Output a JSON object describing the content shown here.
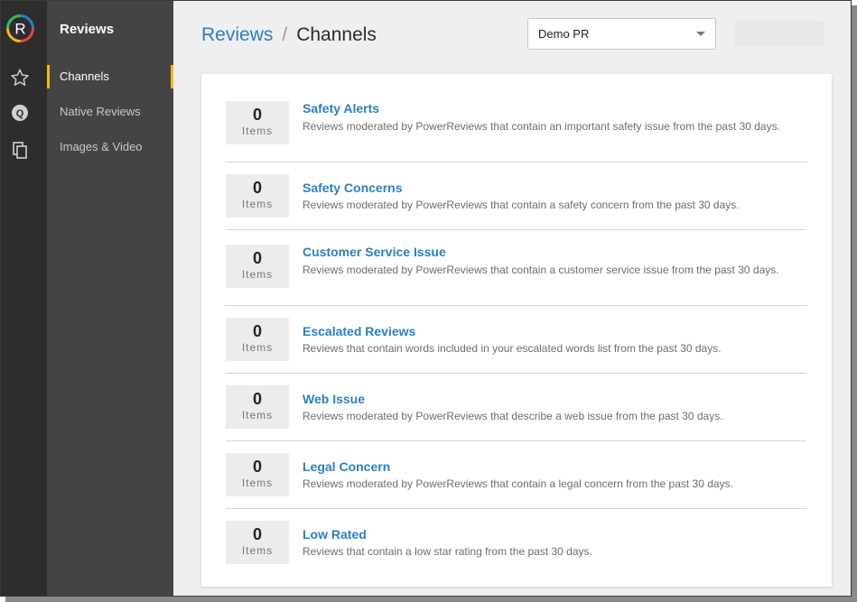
{
  "app": {
    "section": "Reviews"
  },
  "rail": {
    "logo_letter": "R",
    "icons": [
      "star-icon",
      "q-icon",
      "images-icon"
    ],
    "q_letter": "Q"
  },
  "nav": {
    "items": [
      {
        "label": "Channels",
        "active": true
      },
      {
        "label": "Native Reviews",
        "active": false
      },
      {
        "label": "Images & Video",
        "active": false
      }
    ]
  },
  "header": {
    "breadcrumb_root": "Reviews",
    "separator": "/",
    "breadcrumb_current": "Channels",
    "account_select": "Demo PR"
  },
  "channels": [
    {
      "count": "0",
      "unit": "Items",
      "title": "Safety Alerts",
      "description": "Reviews moderated by PowerReviews that contain an important safety issue from the past 30 days."
    },
    {
      "count": "0",
      "unit": "Items",
      "title": "Safety Concerns",
      "description": "Reviews moderated by PowerReviews that contain a safety concern from the past 30 days."
    },
    {
      "count": "0",
      "unit": "Items",
      "title": "Customer Service Issue",
      "description": "Reviews moderated by PowerReviews that contain a customer service issue from the past 30 days."
    },
    {
      "count": "0",
      "unit": "Items",
      "title": "Escalated Reviews",
      "description": "Reviews that contain words included in your escalated words list from the past 30 days."
    },
    {
      "count": "0",
      "unit": "Items",
      "title": "Web Issue",
      "description": "Reviews moderated by PowerReviews that describe a web issue from the past 30 days."
    },
    {
      "count": "0",
      "unit": "Items",
      "title": "Legal Concern",
      "description": "Reviews moderated by PowerReviews that contain a legal concern from the past 30 days."
    },
    {
      "count": "0",
      "unit": "Items",
      "title": "Low Rated",
      "description": "Reviews that contain a low star rating from the past 30 days."
    }
  ],
  "colors": {
    "accent": "#2a7fc4",
    "active_marker": "#f5b71c",
    "rail": "#2d2d2d",
    "nav": "#444444"
  }
}
